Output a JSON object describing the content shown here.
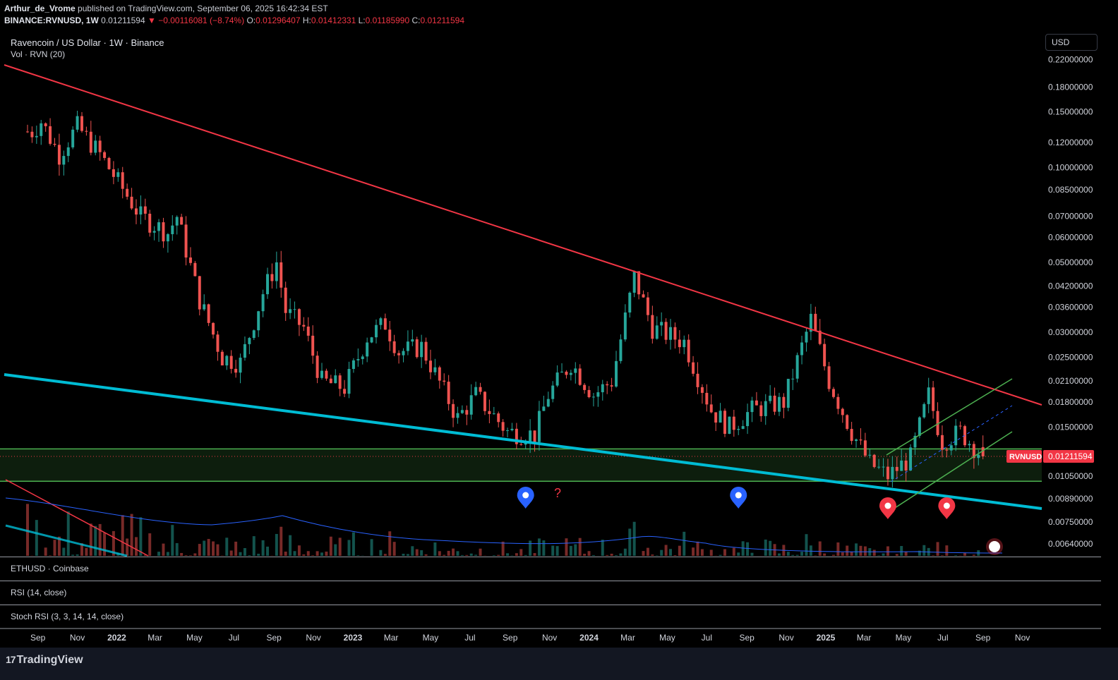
{
  "header": {
    "author": "Arthur_de_Vrome",
    "published": "published on TradingView.com, September 06, 2025 16:42:34 EST",
    "symbol": "BINANCE:RVNUSD, 1W",
    "last": "0.01211594",
    "change": "▼ −0.00116081 (−8.74%)",
    "o_label": "O:",
    "o_val": "0.01296407",
    "h_label": "H:",
    "h_val": "0.01412331",
    "l_label": "L:",
    "l_val": "0.01185990",
    "c_label": "C:",
    "c_val": "0.01211594"
  },
  "title": "Ravencoin / US Dollar · 1W · Binance",
  "volume_label": "Vol · RVN (20)",
  "currency_button": "USD",
  "panes": {
    "eth": "ETHUSD · Coinbase",
    "rsi": "RSI (14, close)",
    "stoch": "Stoch RSI (3, 3, 14, 14, close)"
  },
  "brand": "TradingView",
  "question_mark": "?",
  "chart_data": {
    "type": "candlestick",
    "title": "Ravencoin / US Dollar · 1W · Binance",
    "yscale": "log",
    "ylim": [
      0.0062,
      0.225
    ],
    "y_ticks": [
      "0.22000000",
      "0.18000000",
      "0.15000000",
      "0.12000000",
      "0.10000000",
      "0.08500000",
      "0.07000000",
      "0.06000000",
      "0.05000000",
      "0.04200000",
      "0.03600000",
      "0.03000000",
      "0.02500000",
      "0.02100000",
      "0.01800000",
      "0.01500000",
      "0.01050000",
      "0.00890000",
      "0.00750000",
      "0.00640000"
    ],
    "x_ticks": [
      "Sep",
      "Nov",
      "2022",
      "Mar",
      "May",
      "Jul",
      "Sep",
      "Nov",
      "2023",
      "Mar",
      "May",
      "Jul",
      "Sep",
      "Nov",
      "2024",
      "Mar",
      "May",
      "Jul",
      "Sep",
      "Nov",
      "2025",
      "Mar",
      "May",
      "Jul",
      "Sep",
      "Nov"
    ],
    "x_range": [
      "2021-08-16",
      "2025-11-20"
    ],
    "current_price": {
      "symbol": "RVNUSD",
      "value": 0.01211594,
      "color": "#f23645"
    },
    "support_zone": [
      0.0101,
      0.0128
    ],
    "closes_approx": [
      [
        "2021-08-23",
        0.13
      ],
      [
        "2021-09-06",
        0.14
      ],
      [
        "2021-10-04",
        0.11
      ],
      [
        "2021-11-01",
        0.135
      ],
      [
        "2021-12-06",
        0.11
      ],
      [
        "2022-01-03",
        0.09
      ],
      [
        "2022-02-07",
        0.07
      ],
      [
        "2022-03-21",
        0.062
      ],
      [
        "2022-04-04",
        0.07
      ],
      [
        "2022-05-09",
        0.038
      ],
      [
        "2022-06-13",
        0.025
      ],
      [
        "2022-07-11",
        0.024
      ],
      [
        "2022-08-15",
        0.04
      ],
      [
        "2022-09-05",
        0.05
      ],
      [
        "2022-09-19",
        0.035
      ],
      [
        "2022-10-17",
        0.031
      ],
      [
        "2022-11-14",
        0.021
      ],
      [
        "2022-12-19",
        0.02
      ],
      [
        "2023-01-23",
        0.029
      ],
      [
        "2023-02-20",
        0.032
      ],
      [
        "2023-03-13",
        0.026
      ],
      [
        "2023-04-17",
        0.027
      ],
      [
        "2023-06-12",
        0.016
      ],
      [
        "2023-07-10",
        0.019
      ],
      [
        "2023-08-28",
        0.0145
      ],
      [
        "2023-10-09",
        0.0142
      ],
      [
        "2023-10-30",
        0.019
      ],
      [
        "2023-12-04",
        0.024
      ],
      [
        "2024-01-08",
        0.019
      ],
      [
        "2024-02-05",
        0.021
      ],
      [
        "2024-03-11",
        0.045
      ],
      [
        "2024-04-08",
        0.031
      ],
      [
        "2024-05-27",
        0.028
      ],
      [
        "2024-07-08",
        0.017
      ],
      [
        "2024-08-05",
        0.015
      ],
      [
        "2024-09-09",
        0.017
      ],
      [
        "2024-10-28",
        0.018
      ],
      [
        "2024-12-09",
        0.033
      ],
      [
        "2025-01-06",
        0.021
      ],
      [
        "2025-02-10",
        0.0145
      ],
      [
        "2025-03-10",
        0.0115
      ],
      [
        "2025-04-07",
        0.0105
      ],
      [
        "2025-05-12",
        0.012
      ],
      [
        "2025-06-09",
        0.019
      ],
      [
        "2025-06-30",
        0.0135
      ],
      [
        "2025-07-28",
        0.0145
      ],
      [
        "2025-09-01",
        0.0121
      ]
    ],
    "markers": [
      {
        "date": "2023-09-25",
        "color": "#2962ff"
      },
      {
        "date": "2024-08-19",
        "color": "#2962ff"
      },
      {
        "date": "2025-04-07",
        "color": "#f23645"
      },
      {
        "date": "2025-07-07",
        "color": "#f23645"
      }
    ]
  },
  "colors": {
    "up": "#26a69a",
    "down": "#ef5350",
    "trend_upper": "#f23645",
    "trend_lower": "#00bcd4",
    "channel": "#4caf50"
  }
}
